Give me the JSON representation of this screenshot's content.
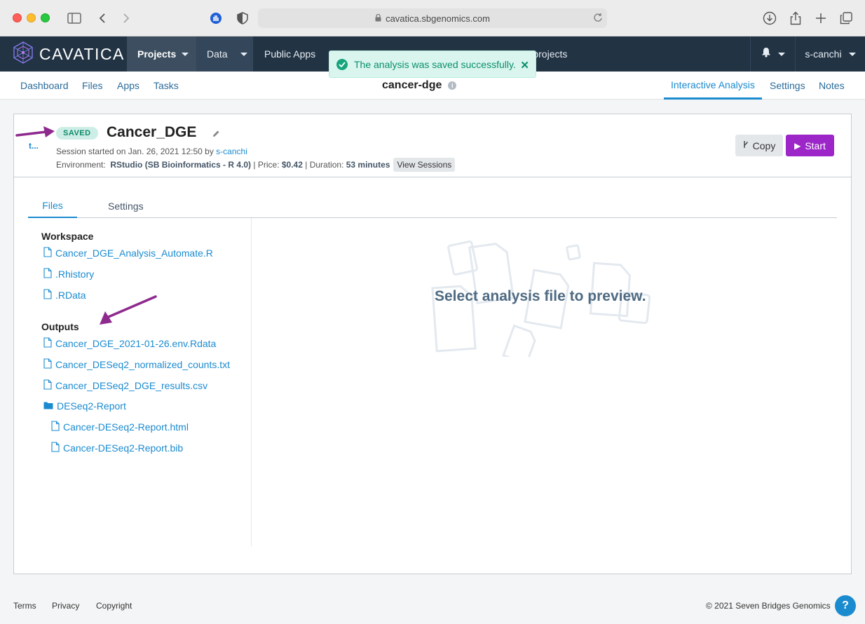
{
  "browser": {
    "url": "cavatica.sbgenomics.com"
  },
  "nav": {
    "logo": "CAVATICA",
    "items": [
      {
        "label": "Projects"
      },
      {
        "label": "Data"
      },
      {
        "label": "Public Apps"
      },
      {
        "label": ""
      },
      {
        "label": ""
      },
      {
        "label": "...lled projects"
      }
    ],
    "user": "s-canchi"
  },
  "toast": {
    "message": "The analysis was saved successfully."
  },
  "subnav": {
    "left": [
      "Dashboard",
      "Files",
      "Apps",
      "Tasks"
    ],
    "project": "cancer-dge",
    "right": [
      "Interactive Analysis",
      "Settings",
      "Notes"
    ]
  },
  "session": {
    "status": "SAVED",
    "title": "Cancer_DGE",
    "tiny_link": "t...",
    "started_prefix": "Session started on Jan. 26, 2021 12:50 by ",
    "started_by": "s-canchi",
    "env_label": "Environment:",
    "env_value": "RStudio (SB Bioinformatics - R 4.0)",
    "price_label": "| Price:",
    "price_value": "$0.42",
    "duration_label": "| Duration:",
    "duration_value": "53 minutes",
    "view_sessions": "View Sessions",
    "copy_label": "Copy",
    "start_label": "Start"
  },
  "tabs": [
    "Files",
    "Settings"
  ],
  "workspace": {
    "heading": "Workspace",
    "files": [
      "Cancer_DGE_Analysis_Automate.R",
      ".Rhistory",
      ".RData"
    ]
  },
  "outputs": {
    "heading": "Outputs",
    "files": [
      "Cancer_DGE_2021-01-26.env.Rdata",
      "Cancer_DESeq2_normalized_counts.txt",
      "Cancer_DESeq2_DGE_results.csv"
    ],
    "folder": "DESeq2-Report",
    "folder_files": [
      "Cancer-DESeq2-Report.html",
      "Cancer-DESeq2-Report.bib"
    ]
  },
  "preview": {
    "message": "Select analysis file to preview."
  },
  "footer": {
    "links": [
      "Terms",
      "Privacy",
      "Copyright"
    ],
    "copyright": "© 2021 Seven Bridges Genomics",
    "help": "?"
  },
  "colors": {
    "nav_bg": "#223344",
    "accent": "#1b8bd0",
    "start_button": "#9d26c9",
    "saved_badge": "#cdeee6",
    "annotation_arrow": "#8e2a8e"
  }
}
